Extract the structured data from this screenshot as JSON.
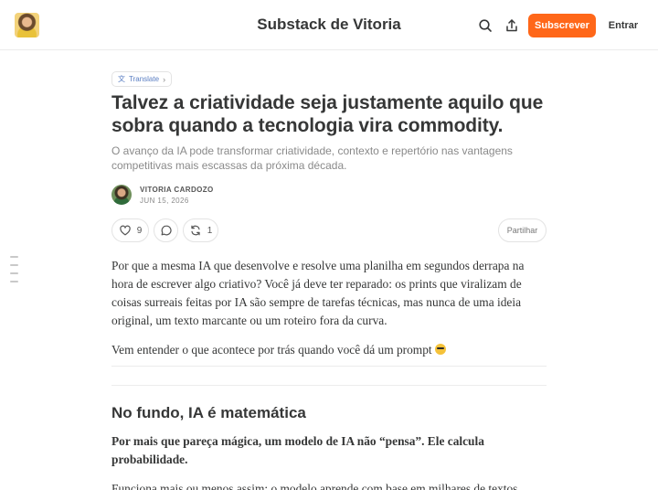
{
  "header": {
    "publication_title": "Substack de Vitoria",
    "subscribe_label": "Subscrever",
    "signin_label": "Entrar"
  },
  "post": {
    "translate_label": "Translate",
    "title": "Talvez a criatividade seja justamente aquilo que sobra quando a tecnologia vira commodity.",
    "subtitle": "O avanço da IA pode transformar criatividade, contexto e repertório nas vantagens competitivas mais escassas da próxima década.",
    "author": "VITORIA CARDOZO",
    "date": "JUN 15, 2026",
    "likes": "9",
    "restacks": "1",
    "share_label": "Partilhar",
    "paragraphs": [
      "Por que a mesma IA que desenvolve e resolve uma planilha em segundos derrapa na hora de escrever algo criativo? Você já deve ter reparado: os prints que viralizam de coisas surreais feitas por IA são sempre de tarefas técnicas, mas nunca de uma ideia original, um texto marcante ou um roteiro fora da curva.",
      "Vem entender o que acontece por trás quando você dá um prompt"
    ],
    "section_heading": "No fundo, IA é matemática",
    "section_lead": "Por mais que pareça mágica, um modelo de IA não “pensa”. Ele calcula probabilidade.",
    "section_next": "Funciona mais ou menos assim: o modelo aprende com base em milhares de textos"
  },
  "colors": {
    "accent": "#ff6719",
    "text": "#363737",
    "muted": "#8a8a8a",
    "border": "#e3e3e3"
  },
  "icons": [
    "publication-avatar",
    "search-icon",
    "share-icon",
    "translate-icon",
    "chevron-right-icon",
    "heart-icon",
    "comment-icon",
    "restack-icon",
    "emoji-icon"
  ]
}
